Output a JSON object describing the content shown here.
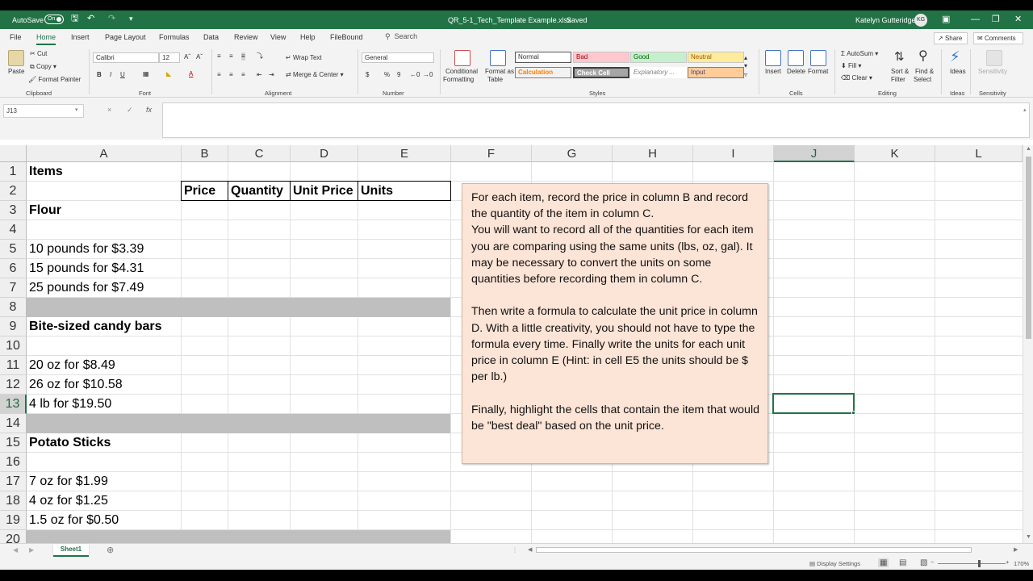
{
  "titlebar": {
    "autosave_label": "AutoSave",
    "autosave_state": "On",
    "filename": "QR_5-1_Tech_Template Example.xlsx",
    "save_status": "Saved",
    "user_name": "Katelyn Gutteridge",
    "user_initials": "KG"
  },
  "menu": {
    "tabs": [
      "File",
      "Home",
      "Insert",
      "Page Layout",
      "Formulas",
      "Data",
      "Review",
      "View",
      "Help",
      "FileBound"
    ],
    "active_tab": "Home",
    "search_placeholder": "Search",
    "share_label": "Share",
    "comments_label": "Comments"
  },
  "ribbon": {
    "clipboard": {
      "paste": "Paste",
      "cut": "Cut",
      "copy": "Copy",
      "format_painter": "Format Painter",
      "label": "Clipboard"
    },
    "font": {
      "font_name": "Calibri",
      "font_size": "12",
      "label": "Font",
      "bold": "B",
      "italic": "I",
      "underline": "U"
    },
    "alignment": {
      "wrap_text": "Wrap Text",
      "merge_center": "Merge & Center",
      "label": "Alignment"
    },
    "number": {
      "format": "General",
      "label": "Number",
      "currency": "$",
      "percent": "%",
      "comma": "9"
    },
    "styles": {
      "conditional_formatting_1": "Conditional",
      "conditional_formatting_2": "Formatting",
      "format_as_table_1": "Format as",
      "format_as_table_2": "Table",
      "normal": "Normal",
      "bad": "Bad",
      "good": "Good",
      "neutral": "Neutral",
      "calculation": "Calculation",
      "check_cell": "Check Cell",
      "explanatory": "Explanatory ...",
      "input": "Input",
      "label": "Styles"
    },
    "cells": {
      "insert": "Insert",
      "delete": "Delete",
      "format": "Format",
      "label": "Cells"
    },
    "editing": {
      "autosum": "AutoSum",
      "fill": "Fill",
      "clear": "Clear",
      "sort_filter_1": "Sort &",
      "sort_filter_2": "Filter",
      "find_select_1": "Find &",
      "find_select_2": "Select",
      "label": "Editing"
    },
    "ideas": {
      "ideas": "Ideas",
      "label": "Ideas"
    },
    "sensitivity": {
      "sensitivity": "Sensitivity",
      "label": "Sensitivity"
    }
  },
  "formula_bar": {
    "name_box": "J13",
    "formula": "",
    "fx": "fx",
    "cancel": "×",
    "enter": "✓"
  },
  "grid": {
    "columns": [
      "A",
      "B",
      "C",
      "D",
      "E",
      "F",
      "G",
      "H",
      "I",
      "J",
      "K",
      "L"
    ],
    "rows": [
      "1",
      "2",
      "3",
      "4",
      "5",
      "6",
      "7",
      "8",
      "9",
      "10",
      "11",
      "12",
      "13",
      "14",
      "15",
      "16",
      "17",
      "18",
      "19",
      "20"
    ],
    "selected_column": "J",
    "selected_row": "13",
    "cells": {
      "A1": "Items",
      "B2": "Price",
      "C2": "Quantity",
      "D2": "Unit Price",
      "E2": "Units",
      "A3": "Flour",
      "A5": "10 pounds for $3.39",
      "A6": "15 pounds for $4.31",
      "A7": "25 pounds for $7.49",
      "A9": "Bite-sized candy bars",
      "A11": "20 oz for $8.49",
      "A12": "26 oz for $10.58",
      "A13": "4 lb for $19.50",
      "A15": "Potato Sticks",
      "A17": "7 oz for $1.99",
      "A18": "4 oz for $1.25",
      "A19": "1.5 oz for $0.50"
    }
  },
  "note": {
    "para1": "For each item, record the price in column B and record the quantity of the item in column C.",
    "para2": "You will want to record all of the quantities for each item you are comparing using the same units (lbs, oz, gal).  It may be necessary to convert the units on some quantities before recording them in column C.",
    "para3": "Then write a formula to calculate the unit price in column D.  With a little creativity, you should not have to type the formula every time.  Finally write the units for each unit price in column E (Hint: in cell E5 the units should be $ per lb.)",
    "para4": "Finally, highlight the cells that contain the item that would be \"best deal\" based on the unit price."
  },
  "sheets": {
    "active": "Sheet1"
  },
  "status": {
    "display_settings": "Display Settings",
    "zoom": "170%"
  }
}
